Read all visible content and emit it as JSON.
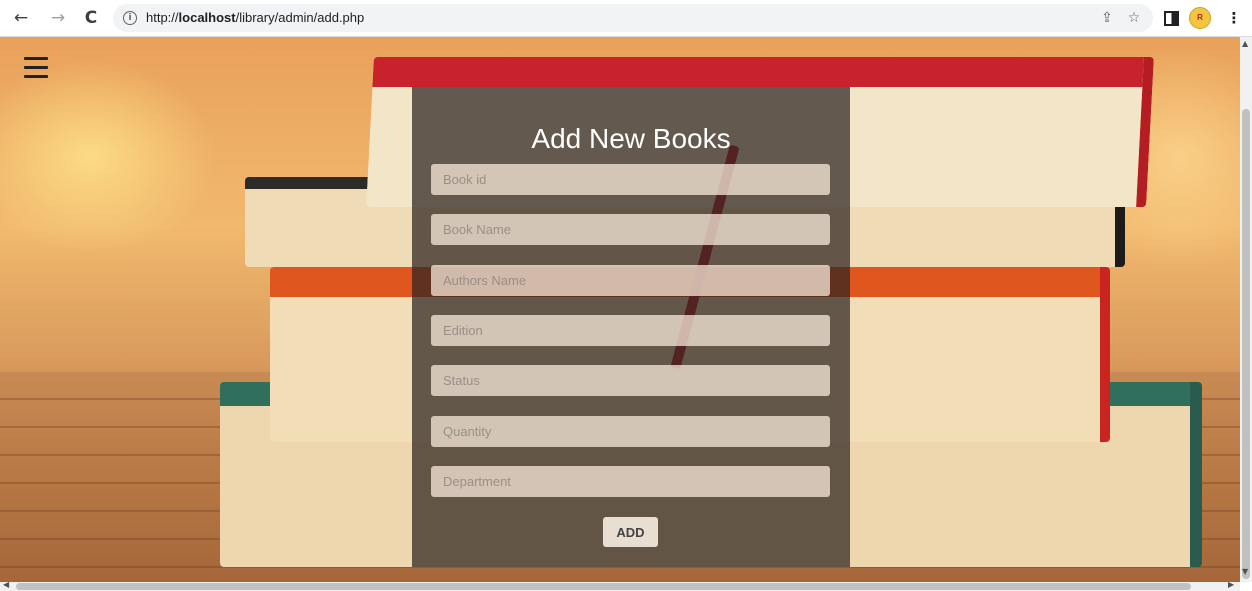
{
  "browser": {
    "back_icon": "←",
    "forward_icon": "→",
    "reload_icon": "C",
    "url_prefix": "http://",
    "url_host": "localhost",
    "url_path": "/library/admin/add.php",
    "share_icon": "⇪",
    "bookmark_icon": "☆",
    "menu_icon": "⋮",
    "profile_label": "R"
  },
  "page": {
    "form": {
      "title": "Add New Books",
      "fields": [
        {
          "placeholder": "Book id",
          "value": ""
        },
        {
          "placeholder": "Book Name",
          "value": ""
        },
        {
          "placeholder": "Authors Name",
          "value": ""
        },
        {
          "placeholder": "Edition",
          "value": ""
        },
        {
          "placeholder": "Status",
          "value": ""
        },
        {
          "placeholder": "Quantity",
          "value": ""
        },
        {
          "placeholder": "Department",
          "value": ""
        }
      ],
      "submit_label": "ADD"
    }
  },
  "scrollbars": {
    "up": "▲",
    "down": "▼",
    "left": "◀",
    "right": "▶"
  }
}
